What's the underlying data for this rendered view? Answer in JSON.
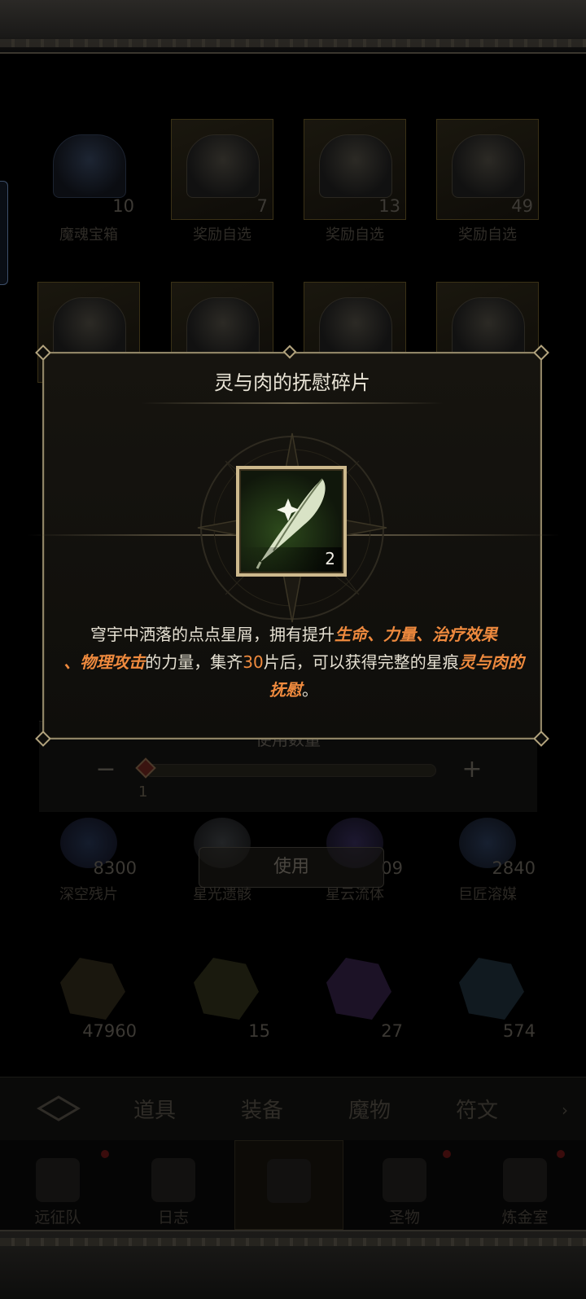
{
  "colors": {
    "highlight": "#ef8a3e",
    "gold_frame": "#cdb98d",
    "popup_border": "#8f8466"
  },
  "background": {
    "row1": [
      {
        "name": "魔魂宝箱",
        "count": "10"
      },
      {
        "name": "奖励自选",
        "count": "7"
      },
      {
        "name": "奖励自选",
        "count": "13"
      },
      {
        "name": "奖励自选",
        "count": "49"
      }
    ],
    "row3": [
      {
        "name": "深空残片",
        "count": "8300"
      },
      {
        "name": "星光遗骸",
        "count": ""
      },
      {
        "name": "星云流体",
        "count": "09"
      },
      {
        "name": "巨匠溶媒",
        "count": "2840"
      }
    ],
    "row4": [
      {
        "count": "47960"
      },
      {
        "count": "15"
      },
      {
        "count": "27"
      },
      {
        "count": "574"
      }
    ],
    "use_panel": {
      "label": "使用数量",
      "minus": "−",
      "plus": "+",
      "value": "1",
      "slider_fraction": 0.0
    },
    "use_button": "使用",
    "tabs": [
      "道具",
      "装备",
      "魔物",
      "符文"
    ],
    "nav": [
      "远征队",
      "日志",
      "",
      "圣物",
      "炼金室"
    ]
  },
  "popup": {
    "title": "灵与肉的抚慰碎片",
    "item_icon": "feather-quill-icon",
    "item_count": "2",
    "desc": {
      "t1": "穹宇中洒落的点点星屑，拥有提升",
      "h1": "生命",
      "s1": "、",
      "h2": "力量",
      "s2": "、",
      "h3": "治疗效果",
      "s3": "、",
      "h4": "物理攻击",
      "t2": "的力量，集齐",
      "num": "30",
      "t3": "片后，可以获得完整的星痕",
      "h5": "灵与肉的抚慰",
      "t4": "。"
    }
  }
}
